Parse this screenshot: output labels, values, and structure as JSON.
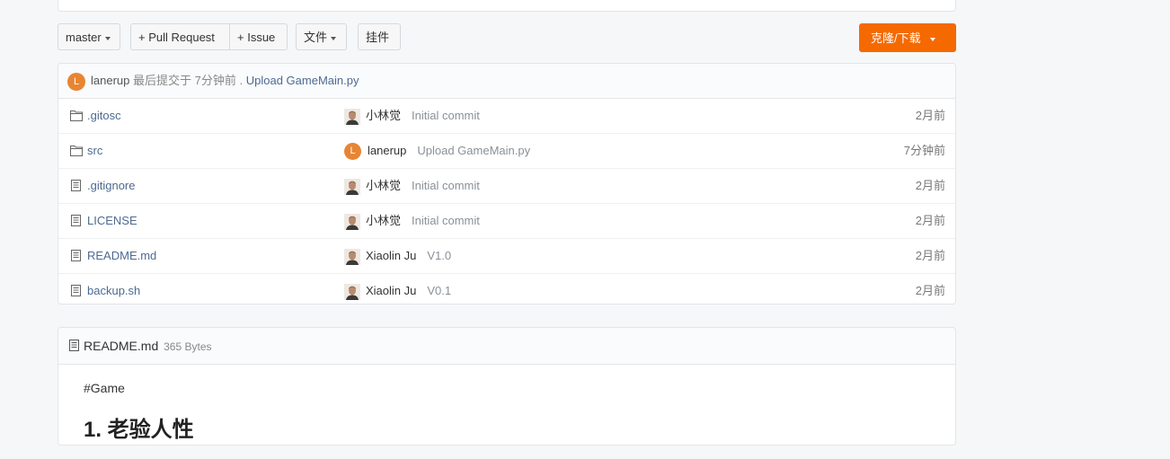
{
  "toolbar": {
    "branch_label": "master",
    "pull_request_label": "+ Pull Request",
    "issue_label": "+ Issue",
    "file_label": "文件",
    "widget_label": "挂件",
    "clone_label": "克隆/下载"
  },
  "last_commit": {
    "avatar_letter": "L",
    "user": "lanerup",
    "text": "最后提交于",
    "time": "7分钟前",
    "separator": ".",
    "message": "Upload GameMain.py"
  },
  "files": [
    {
      "type": "folder",
      "name": ".gitosc",
      "avatar": "photo",
      "author": "小林觉",
      "message": "Initial commit",
      "time": "2月前"
    },
    {
      "type": "folder",
      "name": "src",
      "avatar": "L",
      "author": "lanerup",
      "message": "Upload GameMain.py",
      "time": "7分钟前"
    },
    {
      "type": "file",
      "name": ".gitignore",
      "avatar": "photo",
      "author": "小林觉",
      "message": "Initial commit",
      "time": "2月前"
    },
    {
      "type": "file",
      "name": "LICENSE",
      "avatar": "photo",
      "author": "小林觉",
      "message": "Initial commit",
      "time": "2月前"
    },
    {
      "type": "file",
      "name": "README.md",
      "avatar": "photo",
      "author": "Xiaolin Ju",
      "message": "V1.0",
      "time": "2月前"
    },
    {
      "type": "file",
      "name": "backup.sh",
      "avatar": "photo",
      "author": "Xiaolin Ju",
      "message": "V0.1",
      "time": "2月前"
    }
  ],
  "readme": {
    "filename": "README.md",
    "size": "365 Bytes",
    "line1": "#Game",
    "heading": "1. 老验人性"
  },
  "colors": {
    "accent": "#f56a00",
    "link": "#4d6a92",
    "avatar_l": "#e88533"
  }
}
